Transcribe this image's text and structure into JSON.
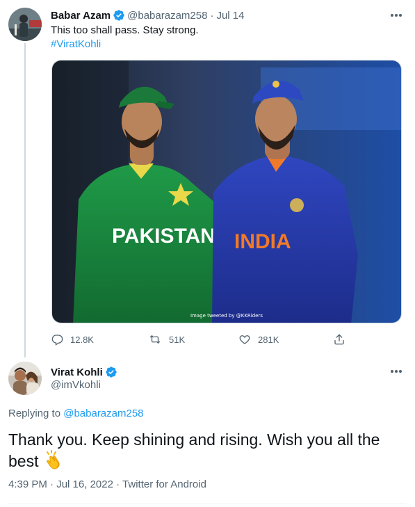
{
  "tweet1": {
    "display_name": "Babar Azam",
    "handle": "@babarazam258",
    "separator": "·",
    "date": "Jul 14",
    "text": "This too shall pass. Stay strong.",
    "hashtag": "#ViratKohli",
    "media_credit": "Image tweeted by @KKRiders",
    "jersey_left": "PAKISTAN",
    "jersey_right": "INDIA",
    "replies": "12.8K",
    "retweets": "51K",
    "likes": "281K",
    "icons": [
      "verified-badge-icon",
      "more-icon",
      "reply-icon",
      "retweet-icon",
      "like-icon",
      "share-icon"
    ]
  },
  "tweet2": {
    "display_name": "Virat Kohli",
    "handle": "@imVkohli",
    "replying_prefix": "Replying to",
    "replying_handle": "@babarazam258",
    "text": "Thank you. Keep shining and rising. Wish you all the best",
    "time": "4:39 PM",
    "date": "Jul 16, 2022",
    "source": "Twitter for Android",
    "separator": "·",
    "icons": [
      "verified-badge-icon",
      "more-icon",
      "clapping-hands-icon"
    ]
  },
  "colors": {
    "link": "#1d9bf0",
    "secondary_text": "#536471",
    "primary_text": "#0f1419",
    "pakistan_green": "#1e8a3e",
    "india_blue": "#2a3fae"
  }
}
